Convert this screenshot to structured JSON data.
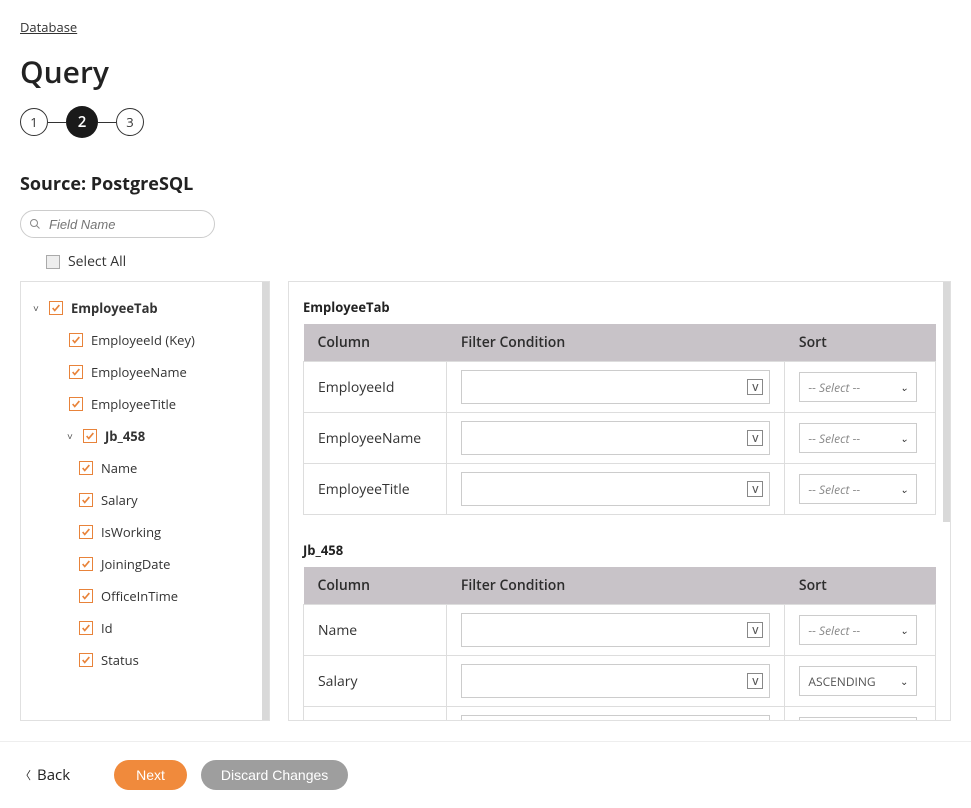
{
  "breadcrumb": "Database",
  "title": "Query",
  "stepper": {
    "steps": [
      "1",
      "2",
      "3"
    ],
    "active": 1
  },
  "source_label": "Source: PostgreSQL",
  "search": {
    "placeholder": "Field Name"
  },
  "select_all": "Select All",
  "tree": {
    "root": {
      "name": "EmployeeTab",
      "children": [
        {
          "name": "EmployeeId (Key)"
        },
        {
          "name": "EmployeeName"
        },
        {
          "name": "EmployeeTitle"
        }
      ],
      "nested": {
        "name": "Jb_458",
        "children": [
          {
            "name": "Name"
          },
          {
            "name": "Salary"
          },
          {
            "name": "IsWorking"
          },
          {
            "name": "JoiningDate"
          },
          {
            "name": "OfficeInTime"
          },
          {
            "name": "Id"
          },
          {
            "name": "Status"
          }
        ]
      }
    }
  },
  "headers": {
    "col": "Column",
    "filter": "Filter Condition",
    "sort": "Sort"
  },
  "sort_placeholder": "-- Select --",
  "tables": [
    {
      "name": "EmployeeTab",
      "rows": [
        {
          "col": "EmployeeId",
          "sort": ""
        },
        {
          "col": "EmployeeName",
          "sort": ""
        },
        {
          "col": "EmployeeTitle",
          "sort": ""
        }
      ]
    },
    {
      "name": "Jb_458",
      "rows": [
        {
          "col": "Name",
          "sort": ""
        },
        {
          "col": "Salary",
          "sort": "ASCENDING"
        }
      ]
    }
  ],
  "footer": {
    "back": "Back",
    "next": "Next",
    "discard": "Discard Changes"
  },
  "v_glyph": "V"
}
